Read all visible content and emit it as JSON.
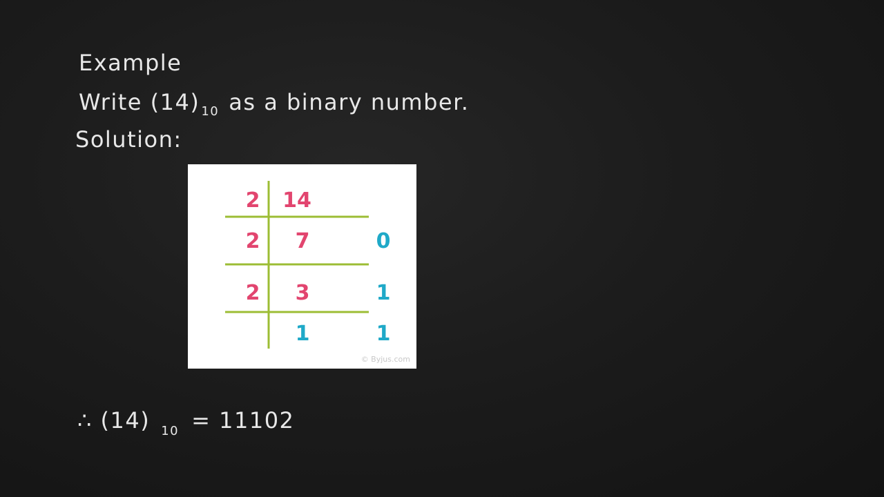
{
  "slide": {
    "heading": "Example",
    "problem": {
      "prefix": "Write (14)",
      "subscript": "10",
      "suffix": "as a binary number."
    },
    "solution_label": "Solution:",
    "figure": {
      "watermark": "© Byjus.com",
      "rows": [
        {
          "divisor": "2",
          "dividend": "14",
          "remainder": ""
        },
        {
          "divisor": "2",
          "dividend": "7",
          "remainder": "0"
        },
        {
          "divisor": "2",
          "dividend": "3",
          "remainder": "1"
        },
        {
          "divisor": "",
          "dividend": "1",
          "remainder": "1"
        }
      ],
      "colors": {
        "divisor": "#e2456f",
        "dividend": "#e2456f",
        "remainder": "#1fa9c8",
        "lines": "#9cbd34"
      }
    },
    "result": {
      "prefix": "∴ (14)",
      "subscript": "10",
      "suffix": "= 11102"
    }
  }
}
